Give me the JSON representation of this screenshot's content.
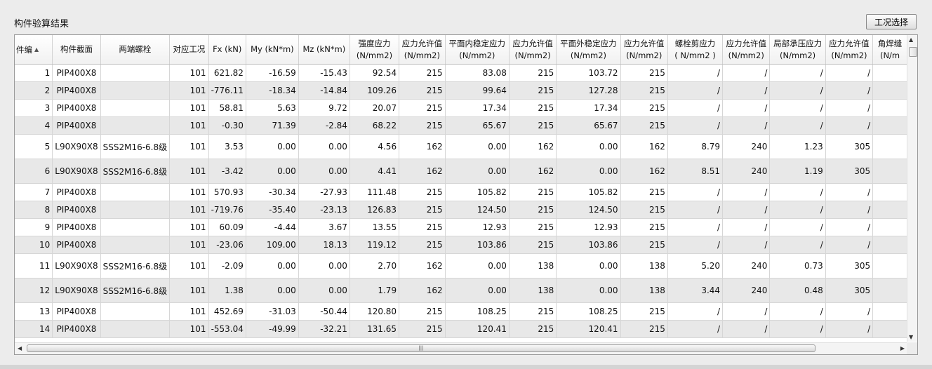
{
  "panel": {
    "title": "构件验算结果"
  },
  "toolbar": {
    "condition_button": "工况选择"
  },
  "columns": [
    {
      "l1": "件编",
      "l2": ""
    },
    {
      "l1": "构件截面",
      "l2": ""
    },
    {
      "l1": "两端螺栓",
      "l2": ""
    },
    {
      "l1": "对应工况",
      "l2": ""
    },
    {
      "l1": "Fx (kN)",
      "l2": ""
    },
    {
      "l1": "My (kN*m)",
      "l2": ""
    },
    {
      "l1": "Mz (kN*m)",
      "l2": ""
    },
    {
      "l1": "强度应力",
      "l2": "(N/mm2)"
    },
    {
      "l1": "应力允许值",
      "l2": "(N/mm2)"
    },
    {
      "l1": "平面内稳定应力",
      "l2": "(N/mm2)"
    },
    {
      "l1": "应力允许值",
      "l2": "(N/mm2)"
    },
    {
      "l1": "平面外稳定应力",
      "l2": "(N/mm2)"
    },
    {
      "l1": "应力允许值",
      "l2": "(N/mm2)"
    },
    {
      "l1": "螺栓剪应力",
      "l2": "( N/mm2 )"
    },
    {
      "l1": "应力允许值",
      "l2": "(N/mm2)"
    },
    {
      "l1": "局部承压应力",
      "l2": "(N/mm2)"
    },
    {
      "l1": "应力允许值",
      "l2": "(N/mm2)"
    },
    {
      "l1": "角焊缝",
      "l2": "(N/m"
    }
  ],
  "rows": [
    [
      "1",
      "PIP400X8",
      "",
      "101",
      "621.82",
      "-16.59",
      "-15.43",
      "92.54",
      "215",
      "83.08",
      "215",
      "103.72",
      "215",
      "/",
      "/",
      "/",
      "/",
      ""
    ],
    [
      "2",
      "PIP400X8",
      "",
      "101",
      "-776.11",
      "-18.34",
      "-14.84",
      "109.26",
      "215",
      "99.64",
      "215",
      "127.28",
      "215",
      "/",
      "/",
      "/",
      "/",
      ""
    ],
    [
      "3",
      "PIP400X8",
      "",
      "101",
      "58.81",
      "5.63",
      "9.72",
      "20.07",
      "215",
      "17.34",
      "215",
      "17.34",
      "215",
      "/",
      "/",
      "/",
      "/",
      ""
    ],
    [
      "4",
      "PIP400X8",
      "",
      "101",
      "-0.30",
      "71.39",
      "-2.84",
      "68.22",
      "215",
      "65.67",
      "215",
      "65.67",
      "215",
      "/",
      "/",
      "/",
      "/",
      ""
    ],
    [
      "5",
      "L90X90X8",
      "SSS2M16-6.8级",
      "101",
      "3.53",
      "0.00",
      "0.00",
      "4.56",
      "162",
      "0.00",
      "162",
      "0.00",
      "162",
      "8.79",
      "240",
      "1.23",
      "305",
      ""
    ],
    [
      "6",
      "L90X90X8",
      "SSS2M16-6.8级",
      "101",
      "-3.42",
      "0.00",
      "0.00",
      "4.41",
      "162",
      "0.00",
      "162",
      "0.00",
      "162",
      "8.51",
      "240",
      "1.19",
      "305",
      ""
    ],
    [
      "7",
      "PIP400X8",
      "",
      "101",
      "570.93",
      "-30.34",
      "-27.93",
      "111.48",
      "215",
      "105.82",
      "215",
      "105.82",
      "215",
      "/",
      "/",
      "/",
      "/",
      ""
    ],
    [
      "8",
      "PIP400X8",
      "",
      "101",
      "-719.76",
      "-35.40",
      "-23.13",
      "126.83",
      "215",
      "124.50",
      "215",
      "124.50",
      "215",
      "/",
      "/",
      "/",
      "/",
      ""
    ],
    [
      "9",
      "PIP400X8",
      "",
      "101",
      "60.09",
      "-4.44",
      "3.67",
      "13.55",
      "215",
      "12.93",
      "215",
      "12.93",
      "215",
      "/",
      "/",
      "/",
      "/",
      ""
    ],
    [
      "10",
      "PIP400X8",
      "",
      "101",
      "-23.06",
      "109.00",
      "18.13",
      "119.12",
      "215",
      "103.86",
      "215",
      "103.86",
      "215",
      "/",
      "/",
      "/",
      "/",
      ""
    ],
    [
      "11",
      "L90X90X8",
      "SSS2M16-6.8级",
      "101",
      "-2.09",
      "0.00",
      "0.00",
      "2.70",
      "162",
      "0.00",
      "138",
      "0.00",
      "138",
      "5.20",
      "240",
      "0.73",
      "305",
      ""
    ],
    [
      "12",
      "L90X90X8",
      "SSS2M16-6.8级",
      "101",
      "1.38",
      "0.00",
      "0.00",
      "1.79",
      "162",
      "0.00",
      "138",
      "0.00",
      "138",
      "3.44",
      "240",
      "0.48",
      "305",
      ""
    ],
    [
      "13",
      "PIP400X8",
      "",
      "101",
      "452.69",
      "-31.03",
      "-50.44",
      "120.80",
      "215",
      "108.25",
      "215",
      "108.25",
      "215",
      "/",
      "/",
      "/",
      "/",
      ""
    ],
    [
      "14",
      "PIP400X8",
      "",
      "101",
      "-553.04",
      "-49.99",
      "-32.21",
      "131.65",
      "215",
      "120.41",
      "215",
      "120.41",
      "215",
      "/",
      "/",
      "/",
      "/",
      ""
    ]
  ],
  "icons": {
    "sort": "▲",
    "scroll_up": "▲",
    "scroll_down": "▼",
    "scroll_left": "◀",
    "scroll_right": "▶",
    "grip": "|||"
  },
  "colors": {
    "alt_row": "#e8e8e8",
    "grid_line": "#d6d6d6",
    "background": "#ececec"
  }
}
